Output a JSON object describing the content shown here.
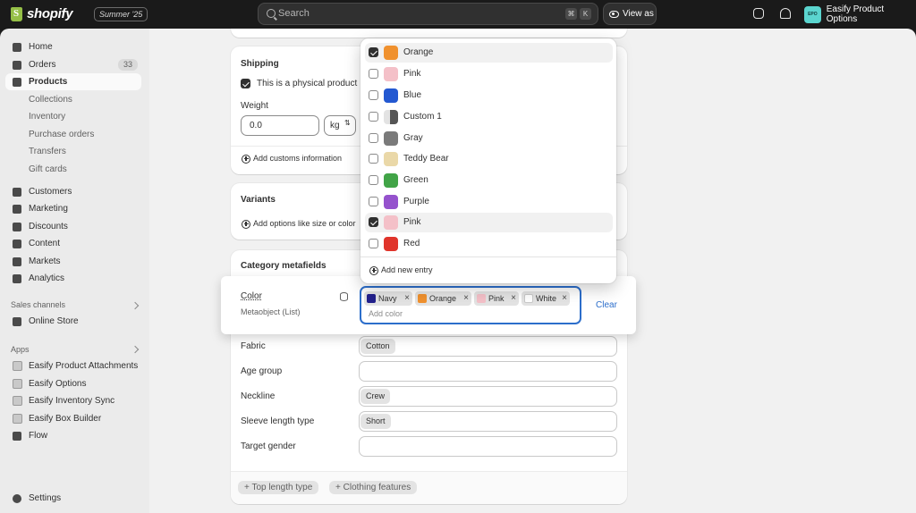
{
  "topbar": {
    "brand": "shopify",
    "edition": "Summer '25",
    "search_placeholder": "Search",
    "shortcut_keys": [
      "⌘",
      "K"
    ],
    "view_as": "View as",
    "store_initials": "EPO",
    "store_name": "Easify Product Options"
  },
  "sidebar": {
    "home": "Home",
    "orders": "Orders",
    "orders_count": "33",
    "products": "Products",
    "product_sub": [
      "Collections",
      "Inventory",
      "Purchase orders",
      "Transfers",
      "Gift cards"
    ],
    "customers": "Customers",
    "marketing": "Marketing",
    "discounts": "Discounts",
    "content": "Content",
    "markets": "Markets",
    "analytics": "Analytics",
    "sales_channels_title": "Sales channels",
    "online_store": "Online Store",
    "apps_title": "Apps",
    "apps": [
      "Easify Product Attachments",
      "Easify Options",
      "Easify Inventory Sync",
      "Easify Box Builder",
      "Flow"
    ],
    "settings": "Settings"
  },
  "shipping": {
    "title": "Shipping",
    "physical_label": "This is a physical product",
    "weight_label": "Weight",
    "weight_value": "0.0",
    "weight_unit": "kg",
    "customs_link": "Add customs information"
  },
  "variants": {
    "title": "Variants",
    "add_options": "Add options like size or color"
  },
  "metafields": {
    "title": "Category metafields",
    "color_label": "Color",
    "color_type": "Metaobject (List)",
    "selected_tags": [
      {
        "label": "Navy",
        "color": "#23218c"
      },
      {
        "label": "Orange",
        "color": "#f0912e"
      },
      {
        "label": "Pink",
        "color": "#f4c0c8"
      },
      {
        "label": "White",
        "color": "#ffffff"
      }
    ],
    "add_color_placeholder": "Add color",
    "clear": "Clear",
    "rows": [
      {
        "label": "Fabric",
        "value": "Cotton"
      },
      {
        "label": "Age group",
        "value": ""
      },
      {
        "label": "Neckline",
        "value": "Crew"
      },
      {
        "label": "Sleeve length type",
        "value": "Short"
      },
      {
        "label": "Target gender",
        "value": ""
      }
    ],
    "suggestions": [
      "Top length type",
      "Clothing features"
    ]
  },
  "dropdown": {
    "options": [
      {
        "label": "Orange",
        "color": "#f0912e",
        "checked": true
      },
      {
        "label": "Pink",
        "color": "#f4c0c8",
        "checked": false
      },
      {
        "label": "Blue",
        "color": "#2358d1",
        "checked": false
      },
      {
        "label": "Custom 1",
        "color": "#555555",
        "checked": false
      },
      {
        "label": "Gray",
        "color": "#7a7a7a",
        "checked": false
      },
      {
        "label": "Teddy Bear",
        "color": "#ead8a8",
        "checked": false
      },
      {
        "label": "Green",
        "color": "#41a447",
        "checked": false
      },
      {
        "label": "Purple",
        "color": "#9552cd",
        "checked": false
      },
      {
        "label": "Pink",
        "color": "#f4c0c8",
        "checked": true
      },
      {
        "label": "Red",
        "color": "#e0342b",
        "checked": false
      }
    ],
    "add_new": "Add new entry"
  }
}
